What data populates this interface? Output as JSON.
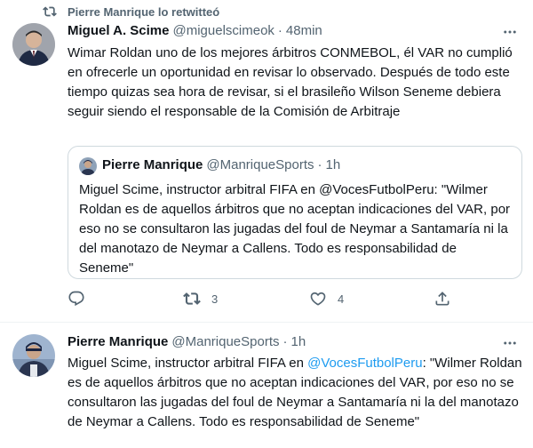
{
  "tweet1": {
    "retweet_label": "Pierre Manrique lo retwitteó",
    "author_name": "Miguel A. Scime",
    "author_handle": "@miguelscimeok",
    "separator": "·",
    "time": "48min",
    "text": "Wimar Roldan uno de los mejores árbitros CONMEBOL, él VAR no cumplió en ofrecerle un oportunidad en revisar lo observado. Después de todo este tiempo quizas sea hora de revisar, si el brasileño Wilson Seneme debiera seguir siendo el responsable de la Comisión de Arbitraje",
    "quote": {
      "author_name": "Pierre Manrique",
      "author_handle": "@ManriqueSports",
      "separator": "·",
      "time": "1h",
      "text": "Miguel Scime, instructor arbitral FIFA en @VocesFutbolPeru: \"Wilmer Roldan es de aquellos árbitros que no aceptan indicaciones del VAR, por eso no se consultaron las jugadas del foul de Neymar a Santamaría ni la del manotazo de Neymar a Callens. Todo es responsabilidad de Seneme\""
    },
    "actions": {
      "reply_count": "",
      "retweet_count": "3",
      "like_count": "4"
    }
  },
  "tweet2": {
    "author_name": "Pierre Manrique",
    "author_handle": "@ManriqueSports",
    "separator": "·",
    "time": "1h",
    "text_before_link": "Miguel Scime, instructor arbitral FIFA en ",
    "link": "@VocesFutbolPeru",
    "text_after_link": ": \"Wilmer Roldan es de aquellos árbitros que no aceptan indicaciones del VAR, por eso no se consultaron las jugadas del foul de Neymar a Santamaría ni la del manotazo de Neymar a Callens. Todo es responsabilidad de Seneme\""
  },
  "colors": {
    "text": "#0f1419",
    "secondary": "#536471",
    "link": "#1d9bf0",
    "border": "#cfd9de"
  },
  "icons": {
    "retweet": "retweet-icon",
    "more": "more-icon",
    "reply": "reply-icon",
    "like": "heart-icon",
    "share": "share-icon"
  }
}
